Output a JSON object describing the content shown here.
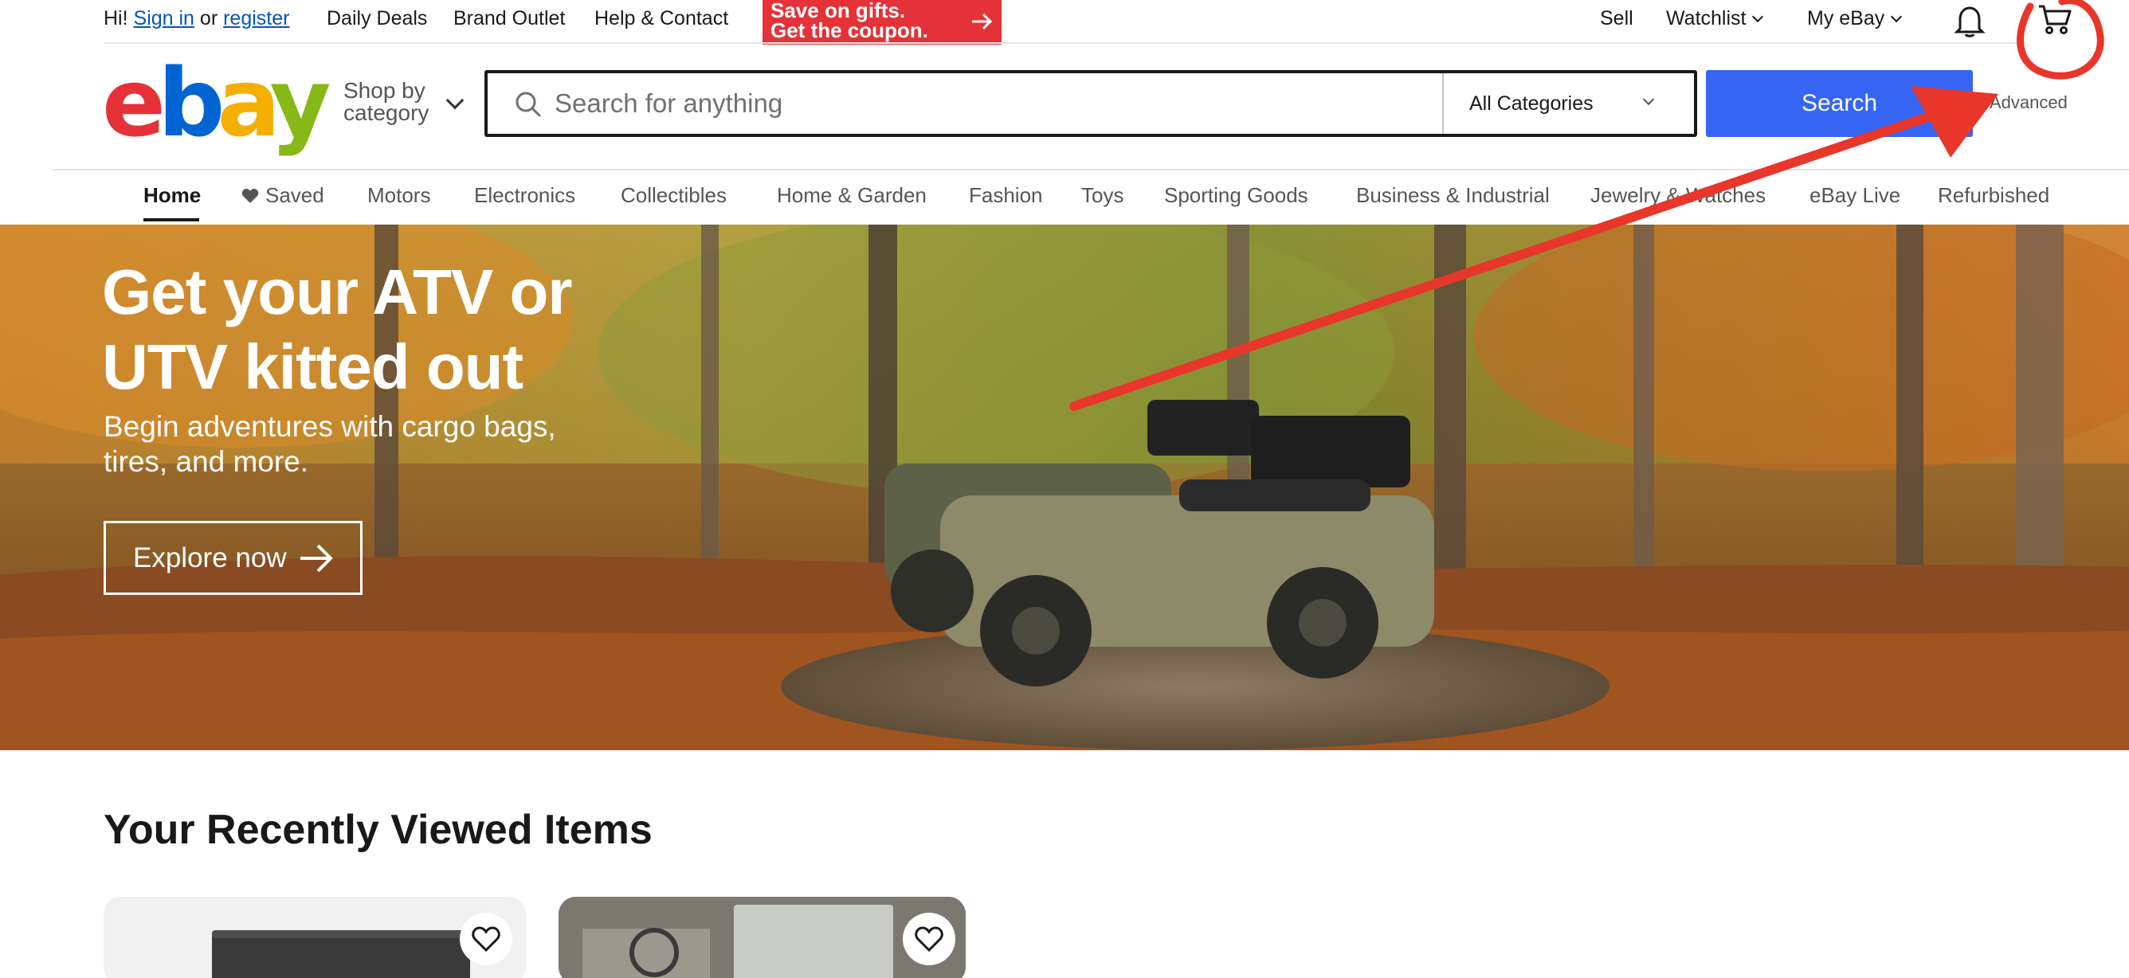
{
  "topbar": {
    "greeting": "Hi!",
    "sign_in": "Sign in",
    "or": "or",
    "register": "register",
    "daily_deals": "Daily Deals",
    "brand_outlet": "Brand Outlet",
    "help_contact": "Help & Contact",
    "promo_line1": "Save on gifts.",
    "promo_line2": "Get the coupon.",
    "sell": "Sell",
    "watchlist": "Watchlist",
    "my_ebay": "My eBay",
    "notification_icon": "bell-icon",
    "cart_icon": "cart-icon"
  },
  "header": {
    "logo_letters": [
      "e",
      "b",
      "a",
      "y"
    ],
    "logo_colors": [
      "#e53238",
      "#0064d2",
      "#f5af02",
      "#86b817"
    ],
    "shop_by_category": "Shop by category",
    "search_placeholder": "Search for anything",
    "category_selected": "All Categories",
    "search_button": "Search",
    "advanced": "Advanced",
    "search_button_color": "#3665f3"
  },
  "nav": {
    "items": [
      "Home",
      "Saved",
      "Motors",
      "Electronics",
      "Collectibles",
      "Home & Garden",
      "Fashion",
      "Toys",
      "Sporting Goods",
      "Business & Industrial",
      "Jewelry & Watches",
      "eBay Live",
      "Refurbished"
    ],
    "active": "Home"
  },
  "hero": {
    "title": "Get your ATV or UTV kitted out",
    "subtitle": "Begin adventures with cargo bags, tires, and more.",
    "cta": "Explore now"
  },
  "recently_viewed": {
    "title": "Your Recently Viewed Items",
    "item_count_visible": 2,
    "favorite_icon": "heart-outline-icon"
  },
  "annotation": {
    "color": "#e8362b",
    "arrow_points_to": "Advanced",
    "circled": "cart-icon"
  }
}
